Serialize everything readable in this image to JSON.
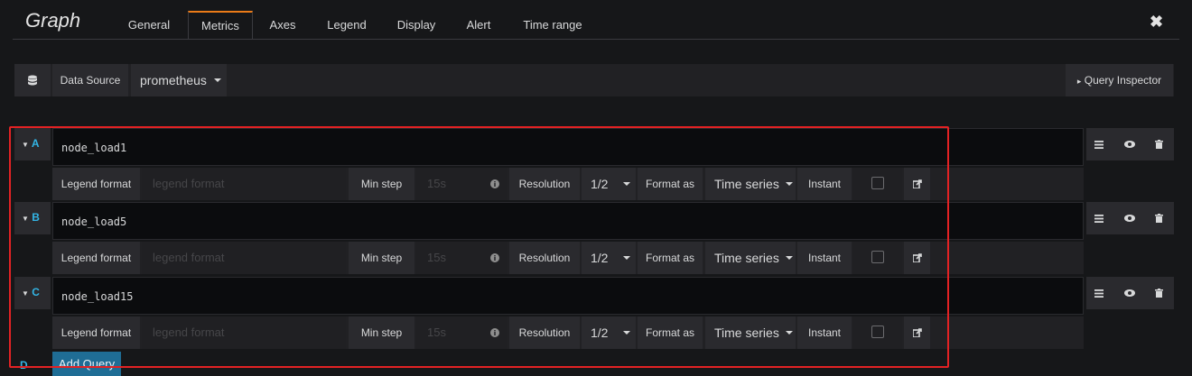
{
  "header": {
    "title": "Graph",
    "tabs": [
      {
        "label": "General"
      },
      {
        "label": "Metrics"
      },
      {
        "label": "Axes"
      },
      {
        "label": "Legend"
      },
      {
        "label": "Display"
      },
      {
        "label": "Alert"
      },
      {
        "label": "Time range"
      }
    ],
    "active_tab": "Metrics",
    "close_glyph": "✖"
  },
  "datasource": {
    "label": "Data Source",
    "value": "prometheus",
    "query_inspector_label": "Query Inspector",
    "query_inspector_glyph": "▸"
  },
  "queries": [
    {
      "ref": "A",
      "expr": "node_load1",
      "legend_label": "Legend format",
      "legend_placeholder": "legend format",
      "min_step_label": "Min step",
      "min_step_placeholder": "15s",
      "resolution_label": "Resolution",
      "resolution_value": "1/2",
      "format_label": "Format as",
      "format_value": "Time series",
      "instant_label": "Instant"
    },
    {
      "ref": "B",
      "expr": "node_load5",
      "legend_label": "Legend format",
      "legend_placeholder": "legend format",
      "min_step_label": "Min step",
      "min_step_placeholder": "15s",
      "resolution_label": "Resolution",
      "resolution_value": "1/2",
      "format_label": "Format as",
      "format_value": "Time series",
      "instant_label": "Instant"
    },
    {
      "ref": "C",
      "expr": "node_load15",
      "legend_label": "Legend format",
      "legend_placeholder": "legend format",
      "min_step_label": "Min step",
      "min_step_placeholder": "15s",
      "resolution_label": "Resolution",
      "resolution_value": "1/2",
      "format_label": "Format as",
      "format_value": "Time series",
      "instant_label": "Instant"
    }
  ],
  "add_query": {
    "ref": "D",
    "label": "Add Query"
  },
  "icons": {
    "database": "database-icon",
    "collapse": "caret-down-icon",
    "menu": "bars-icon",
    "visibility": "eye-icon",
    "delete": "trash-icon",
    "info": "info-circle-icon",
    "external": "external-link-icon"
  },
  "colors": {
    "accent": "#eb7b18",
    "ref_letter": "#33b5e5",
    "primary_button": "#1f6d95",
    "highlight": "#e32224"
  }
}
